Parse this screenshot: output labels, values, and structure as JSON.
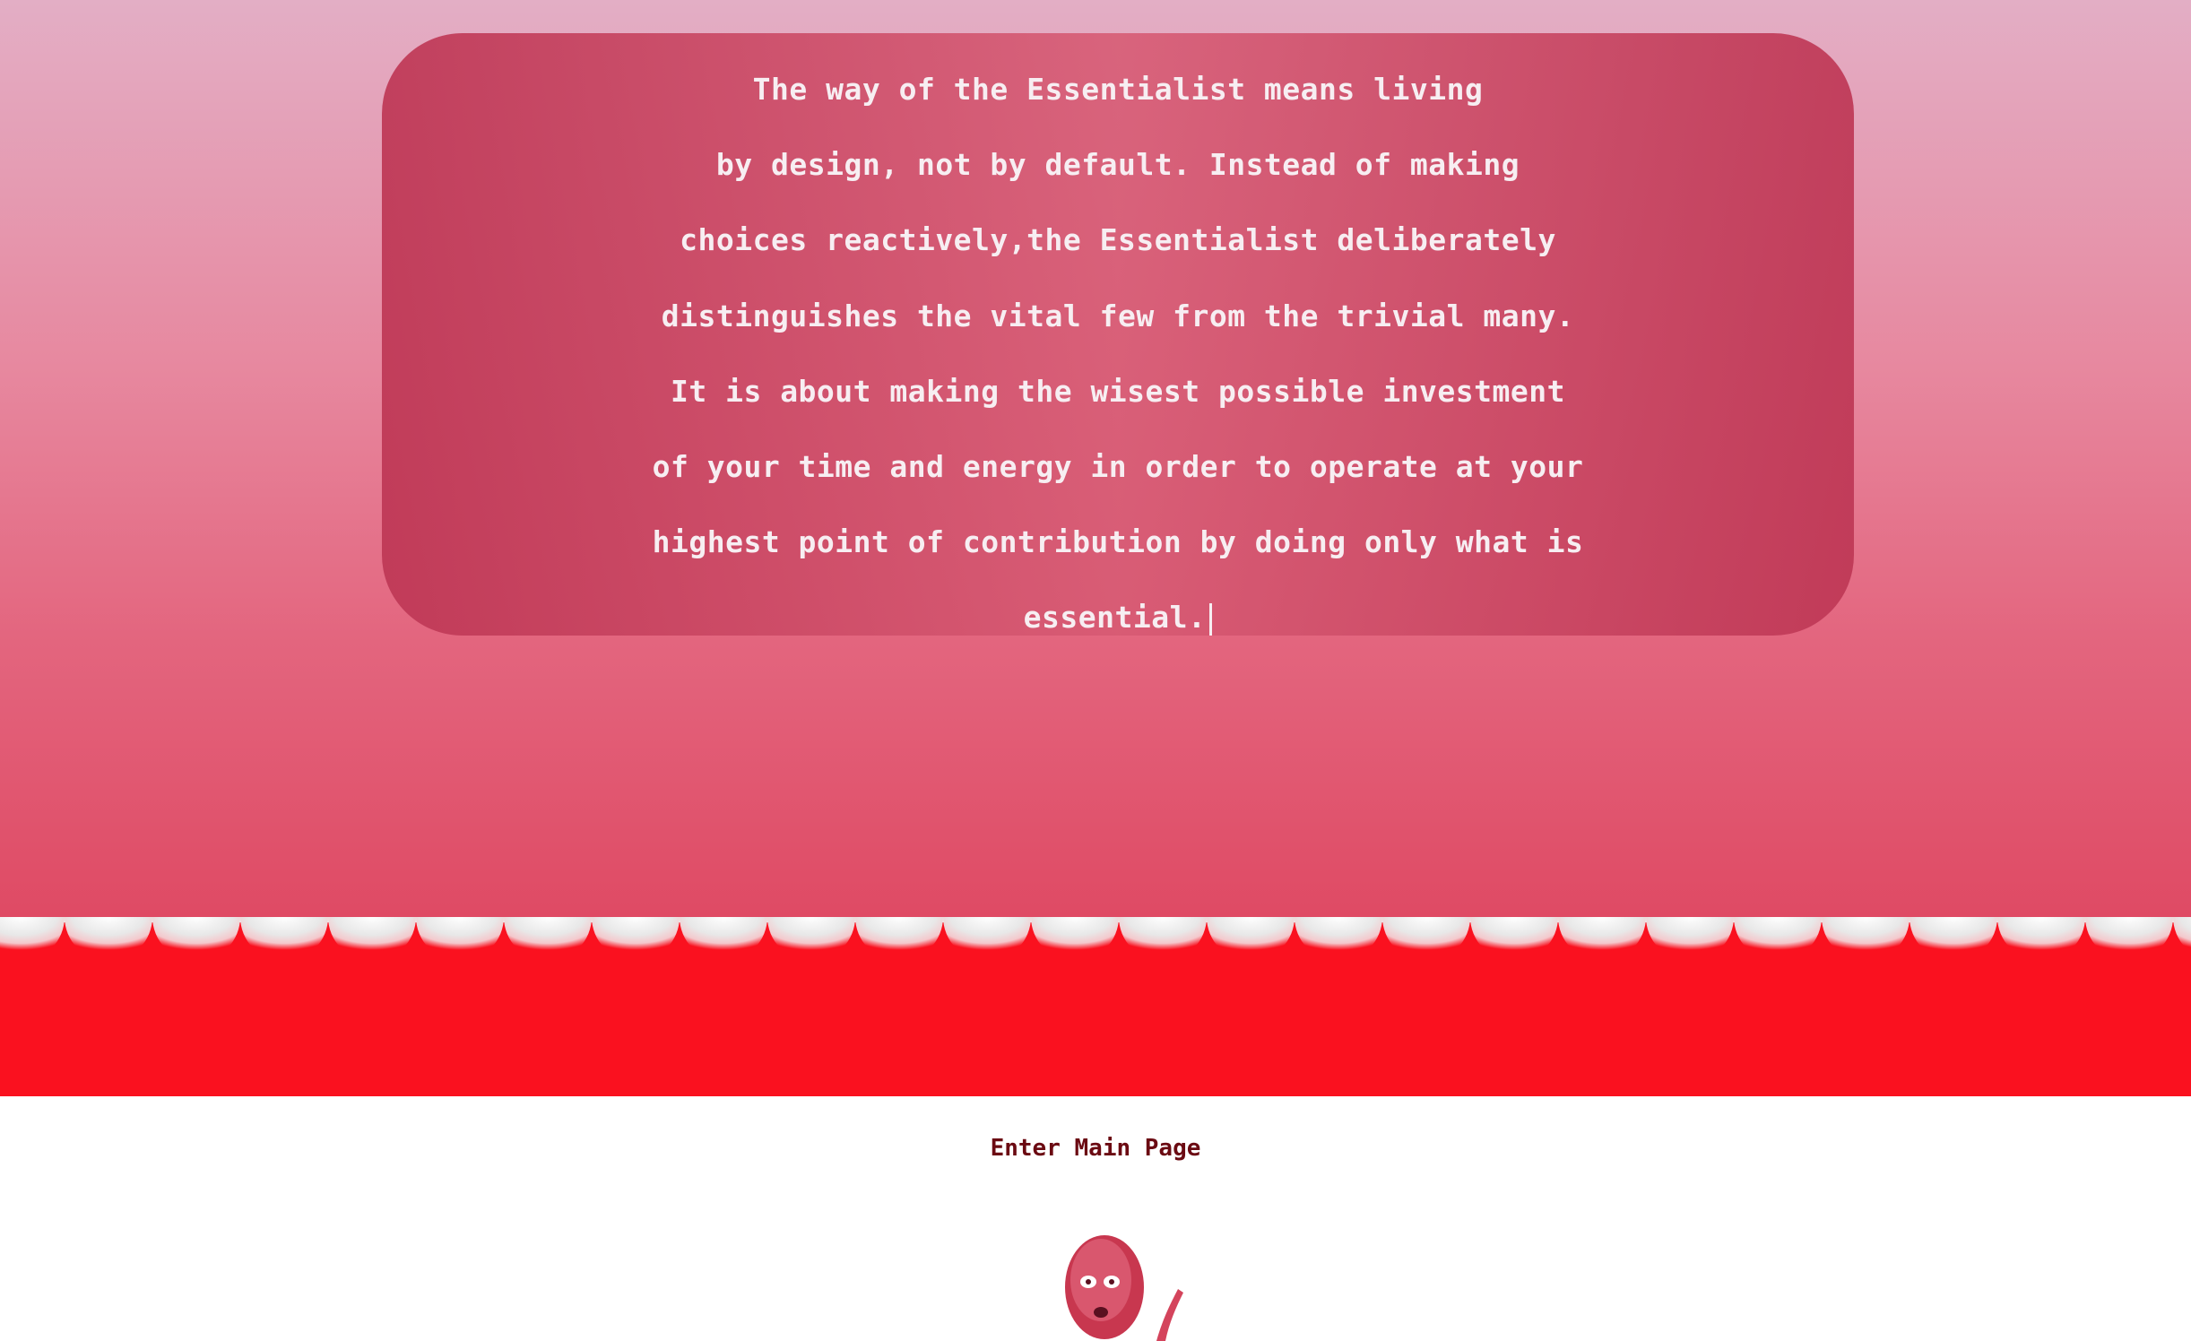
{
  "quote": {
    "lines": [
      "The way of the Essentialist means living",
      "by design, not by default. Instead of making",
      "choices reactively,the Essentialist deliberately",
      "distinguishes the vital few from the trivial many.",
      "It is about making the wisest possible investment",
      "of your time and energy in order to operate at your",
      "highest point of contribution by doing only what is",
      "essential."
    ]
  },
  "enter_link": {
    "label": "Enter Main Page"
  },
  "mascot": {
    "icon": "red-alien-mascot-icon"
  },
  "colors": {
    "hero_top": "#e3aec5",
    "hero_bottom": "#df4a64",
    "band_red": "#fa111f",
    "link_text": "#6b0a12"
  }
}
